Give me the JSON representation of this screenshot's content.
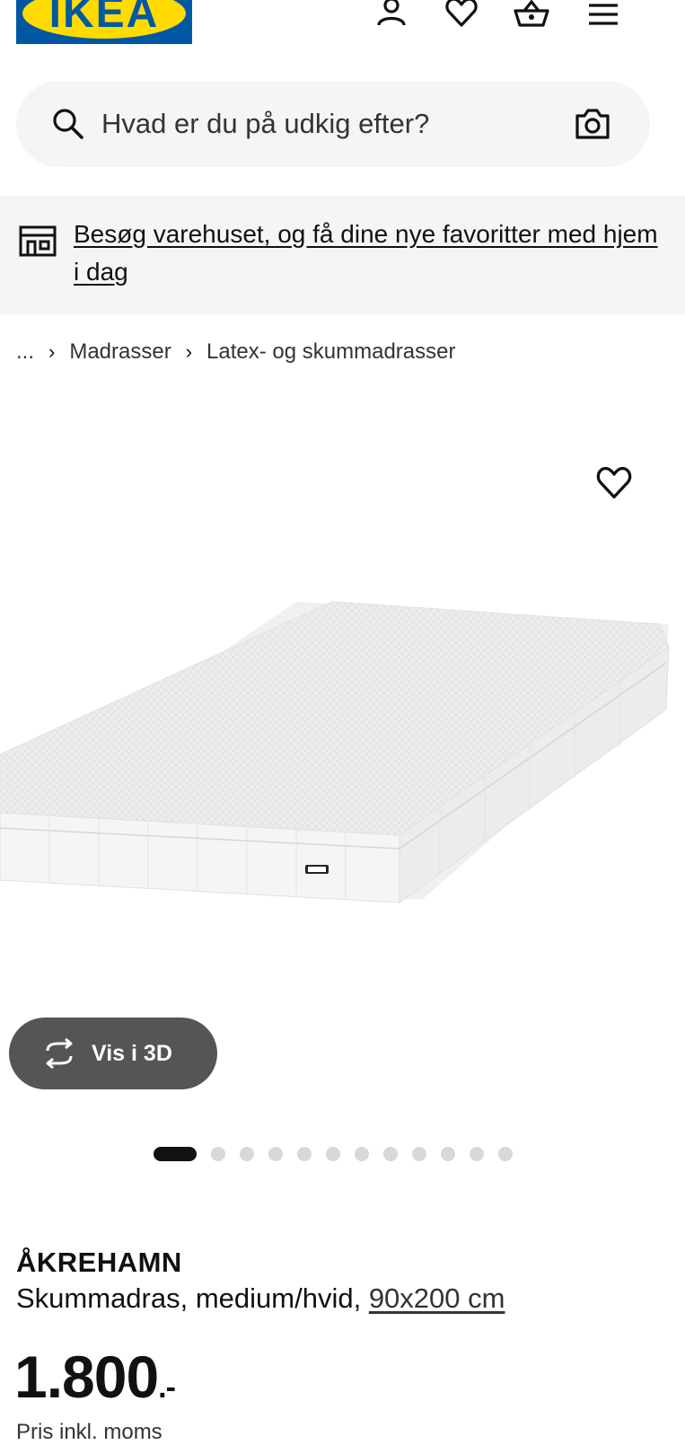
{
  "header": {
    "logo_text": "IKEA",
    "icons": [
      "profile-icon",
      "heart-icon",
      "basket-icon",
      "menu-icon"
    ]
  },
  "search": {
    "placeholder": "Hvad er du på udkig efter?",
    "icon": "search-icon",
    "camera_icon": "camera-icon"
  },
  "store_banner": {
    "icon": "store-icon",
    "text": "Besøg varehuset, og få dine nye favoritter med hjem i dag"
  },
  "breadcrumb": {
    "ellipsis": "...",
    "items": [
      "Madrasser",
      "Latex- og skummadrasser"
    ]
  },
  "gallery": {
    "view_3d_label": "Vis i 3D",
    "total_images": 13,
    "active_index": 0
  },
  "product": {
    "name": "ÅKREHAMN",
    "description": "Skummadras, medium/hvid,",
    "size": "90x200 cm",
    "price": "1.800",
    "price_suffix": ".-",
    "vat_note": "Pris inkl. moms"
  },
  "colors": {
    "brand_blue": "#0058a3",
    "brand_yellow": "#ffdb00",
    "banner_bg": "#f5f5f5",
    "button_3d_bg": "#555555"
  }
}
